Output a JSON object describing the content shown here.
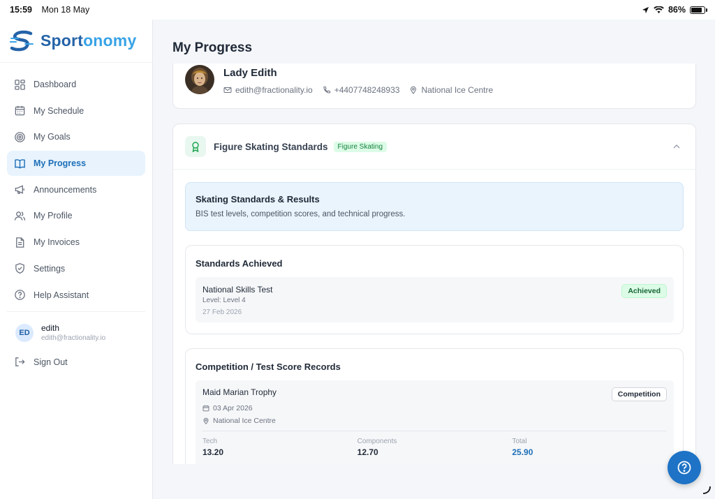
{
  "status_bar": {
    "time": "15:59",
    "date": "Mon 18 May",
    "battery": "86%",
    "battery_level": 0.86
  },
  "brand": {
    "name_a": "Sport",
    "name_b": "onomy"
  },
  "sidebar": {
    "items": [
      {
        "label": "Dashboard",
        "icon": "dashboard-icon"
      },
      {
        "label": "My Schedule",
        "icon": "calendar-icon"
      },
      {
        "label": "My Goals",
        "icon": "target-icon"
      },
      {
        "label": "My Progress",
        "icon": "book-icon",
        "active": true
      },
      {
        "label": "Announcements",
        "icon": "megaphone-icon"
      },
      {
        "label": "My Profile",
        "icon": "users-icon"
      },
      {
        "label": "My Invoices",
        "icon": "document-icon"
      },
      {
        "label": "Settings",
        "icon": "shield-icon"
      },
      {
        "label": "Help Assistant",
        "icon": "help-circle-icon"
      }
    ],
    "user": {
      "initials": "ED",
      "name": "edith",
      "email": "edith@fractionality.io"
    },
    "sign_out": "Sign Out"
  },
  "page": {
    "title": "My Progress"
  },
  "profile": {
    "name": "Lady Edith",
    "email": "edith@fractionality.io",
    "phone": "+4407748248933",
    "location": "National Ice Centre"
  },
  "standards": {
    "title": "Figure Skating Standards",
    "tag": "Figure Skating",
    "info_title": "Skating Standards & Results",
    "info_sub": "BIS test levels, competition scores, and technical progress.",
    "achieved": {
      "title": "Standards Achieved",
      "items": [
        {
          "name": "National Skills Test",
          "level": "Level: Level 4",
          "date": "27 Feb 2026",
          "status": "Achieved"
        }
      ]
    },
    "records": {
      "title": "Competition / Test Score Records",
      "items": [
        {
          "name": "Maid Marian Trophy",
          "type": "Competition",
          "date": "03 Apr 2026",
          "location": "National Ice Centre",
          "tech_label": "Tech",
          "tech": "13.20",
          "components_label": "Components",
          "components": "12.70",
          "total_label": "Total",
          "total": "25.90"
        }
      ]
    }
  },
  "colors": {
    "accent": "#1e73c6",
    "active_bg": "#e8f3fd",
    "success": "#15803d"
  }
}
